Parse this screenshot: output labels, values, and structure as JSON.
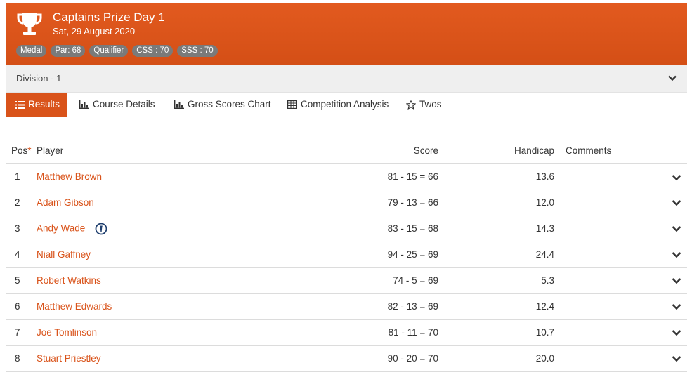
{
  "header": {
    "title": "Captains Prize Day 1",
    "date": "Sat, 29 August 2020",
    "badges": [
      "Medal",
      "Par: 68",
      "Qualifier",
      "CSS : 70",
      "SSS : 70"
    ],
    "trophy_icon": "trophy-icon",
    "color": "#d9531a"
  },
  "division": {
    "label": "Division - 1",
    "chevron_icon": "chevron-down-icon"
  },
  "tabs": [
    {
      "label": "Results",
      "icon": "list-icon",
      "active": true
    },
    {
      "label": "Course Details",
      "icon": "bar-chart-icon",
      "active": false
    },
    {
      "label": "Gross Scores Chart",
      "icon": "bar-chart-icon",
      "active": false
    },
    {
      "label": "Competition Analysis",
      "icon": "table-icon",
      "active": false
    },
    {
      "label": "Twos",
      "icon": "star-icon",
      "active": false
    }
  ],
  "table": {
    "headers": {
      "pos": "Pos",
      "pos_marker": "*",
      "player": "Player",
      "score": "Score",
      "handicap": "Handicap",
      "comments": "Comments"
    },
    "rows": [
      {
        "pos": "1",
        "player": "Matthew Brown",
        "score": "81 - 15 = 66",
        "handicap": "13.6",
        "comments": ""
      },
      {
        "pos": "2",
        "player": "Adam Gibson",
        "score": "79 - 13 = 66",
        "handicap": "12.0",
        "comments": ""
      },
      {
        "pos": "3",
        "player": "Andy Wade",
        "score": "83 - 15 = 68",
        "handicap": "14.3",
        "comments": "",
        "badge_icon": "open-championship-icon"
      },
      {
        "pos": "4",
        "player": "Niall Gaffney",
        "score": "94 - 25 = 69",
        "handicap": "24.4",
        "comments": ""
      },
      {
        "pos": "5",
        "player": "Robert Watkins",
        "score": "74 - 5 = 69",
        "handicap": "5.3",
        "comments": ""
      },
      {
        "pos": "6",
        "player": "Matthew Edwards",
        "score": "82 - 13 = 69",
        "handicap": "12.4",
        "comments": ""
      },
      {
        "pos": "7",
        "player": "Joe Tomlinson",
        "score": "81 - 11 = 70",
        "handicap": "10.7",
        "comments": ""
      },
      {
        "pos": "8",
        "player": "Stuart Priestley",
        "score": "90 - 20 = 70",
        "handicap": "20.0",
        "comments": ""
      }
    ]
  }
}
